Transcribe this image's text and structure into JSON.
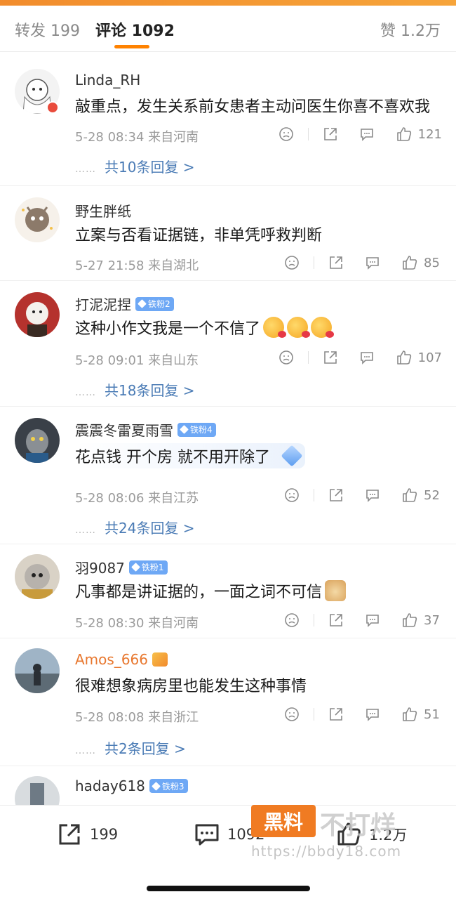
{
  "tabs": {
    "repost": "转发 199",
    "comments": "评论 1092",
    "likes": "赞 1.2万"
  },
  "comments": [
    {
      "name": "Linda_RH",
      "text": "敲重点，发生关系前女患者主动问医生你喜不喜欢我",
      "meta": "5-28 08:34 来自河南",
      "likes": "121",
      "replies": "共10条回复 >"
    },
    {
      "name": "野生胖纸",
      "text": "立案与否看证据链，非单凭呼救判断",
      "meta": "5-27 21:58 来自湖北",
      "likes": "85"
    },
    {
      "name": "打泥泥捏",
      "badge": "铁粉2",
      "text": "这种小作文我是一个不信了",
      "meta": "5-28 09:01 来自山东",
      "likes": "107",
      "replies": "共18条回复 >"
    },
    {
      "name": "震震冬雷夏雨雪",
      "badge": "铁粉4",
      "text": "花点钱 开个房 就不用开除了",
      "meta": "5-28 08:06 来自江苏",
      "likes": "52",
      "replies": "共24条回复 >"
    },
    {
      "name": "羽9087",
      "badge": "铁粉1",
      "text": "凡事都是讲证据的，一面之词不可信",
      "meta": "5-28 08:30 来自河南",
      "likes": "37"
    },
    {
      "name": "Amos_666",
      "text": "很难想象病房里也能发生这种事情",
      "meta": "5-28 08:08 来自浙江",
      "likes": "51",
      "replies": "共2条回复 >"
    },
    {
      "name": "haday618",
      "badge": "铁粉3"
    }
  ],
  "reply_dots": "……",
  "bottom": {
    "repost_count": "199",
    "comment_count": "1092",
    "like_count": "1.2万"
  },
  "watermark": {
    "brand": "黑料",
    "slogan": "不打烊",
    "url": "https://bbdy18.com"
  },
  "colors": {
    "accent": "#ff8200",
    "reply_link": "#4a7bb5",
    "fan_badge": "#6ea8f5",
    "vip_name": "#e8772e"
  }
}
